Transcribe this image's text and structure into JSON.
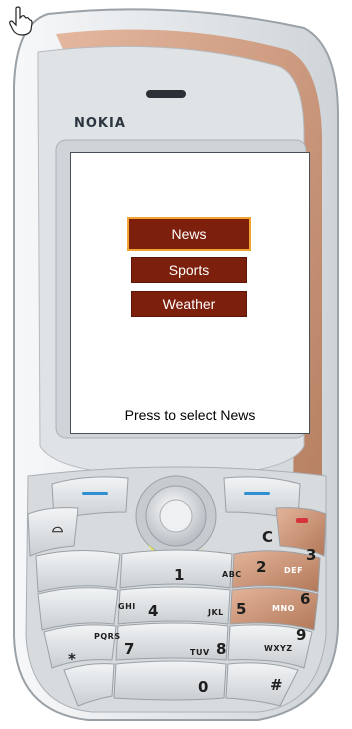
{
  "phone": {
    "brand": "NOKIA"
  },
  "screen": {
    "menu": [
      {
        "label": "News",
        "selected": true
      },
      {
        "label": "Sports",
        "selected": false
      },
      {
        "label": "Weather",
        "selected": false
      }
    ],
    "status_text": "Press to select News"
  },
  "keypad": {
    "keys": [
      {
        "digit": "1",
        "letters": ""
      },
      {
        "digit": "2",
        "letters": "ABC"
      },
      {
        "digit": "3",
        "letters": "DEF"
      },
      {
        "digit": "4",
        "letters": "GHI"
      },
      {
        "digit": "5",
        "letters": "JKL"
      },
      {
        "digit": "6",
        "letters": "MNO"
      },
      {
        "digit": "7",
        "letters": "PQRS"
      },
      {
        "digit": "8",
        "letters": "TUV"
      },
      {
        "digit": "9",
        "letters": "WXYZ"
      },
      {
        "digit": "0",
        "letters": ""
      },
      {
        "digit": "*",
        "letters": ""
      },
      {
        "digit": "#",
        "letters": ""
      }
    ],
    "clear_label": "C"
  },
  "colors": {
    "menu_item_bg": "#7c1f0c",
    "menu_selected_outline": "#f3a534",
    "phone_body": "#e8ecef",
    "accent_copper": "#c98e70",
    "softkey_blue": "#2f8fd1",
    "end_key_red": "#d6333a"
  }
}
